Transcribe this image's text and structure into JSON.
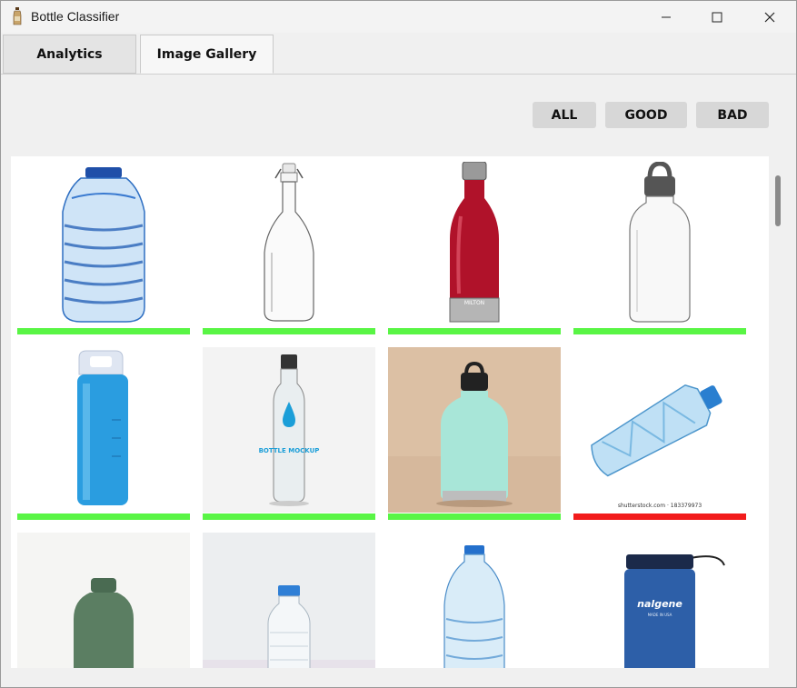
{
  "window": {
    "title": "Bottle Classifier",
    "icon": "bottle-icon",
    "controls": [
      "minimize-icon",
      "maximize-icon",
      "close-icon"
    ]
  },
  "tabs": [
    {
      "label": "Analytics",
      "active": false
    },
    {
      "label": "Image Gallery",
      "active": true
    }
  ],
  "filters": {
    "all_label": "ALL",
    "good_label": "GOOD",
    "bad_label": "BAD"
  },
  "colors": {
    "good": "#59f545",
    "bad": "#f21b1b",
    "filter_button": "#d7d7d7"
  },
  "gallery": [
    {
      "name": "water-jug-bottle",
      "status": "GOOD"
    },
    {
      "name": "glass-swing-top-bottle",
      "status": "GOOD"
    },
    {
      "name": "red-metal-bottle",
      "status": "GOOD"
    },
    {
      "name": "clear-bottle-grey-loop-cap",
      "status": "GOOD"
    },
    {
      "name": "blue-sport-bottle",
      "status": "GOOD"
    },
    {
      "name": "bottle-mockup",
      "status": "GOOD"
    },
    {
      "name": "mint-insulated-bottle",
      "status": "GOOD"
    },
    {
      "name": "crushed-plastic-bottle",
      "status": "BAD"
    },
    {
      "name": "green-matte-bottle",
      "status": null
    },
    {
      "name": "small-plastic-water-bottle",
      "status": null
    },
    {
      "name": "ridged-water-bottle",
      "status": null
    },
    {
      "name": "blue-nalgene-bottle",
      "status": null
    }
  ],
  "image_text": {
    "milton": "MILTON",
    "mockup": "BOTTLE MOCKUP",
    "shutterstock": "shutterstock.com · 183379973",
    "nalgene": "nalgene",
    "nalgene_sub": "MADE IN USA"
  }
}
